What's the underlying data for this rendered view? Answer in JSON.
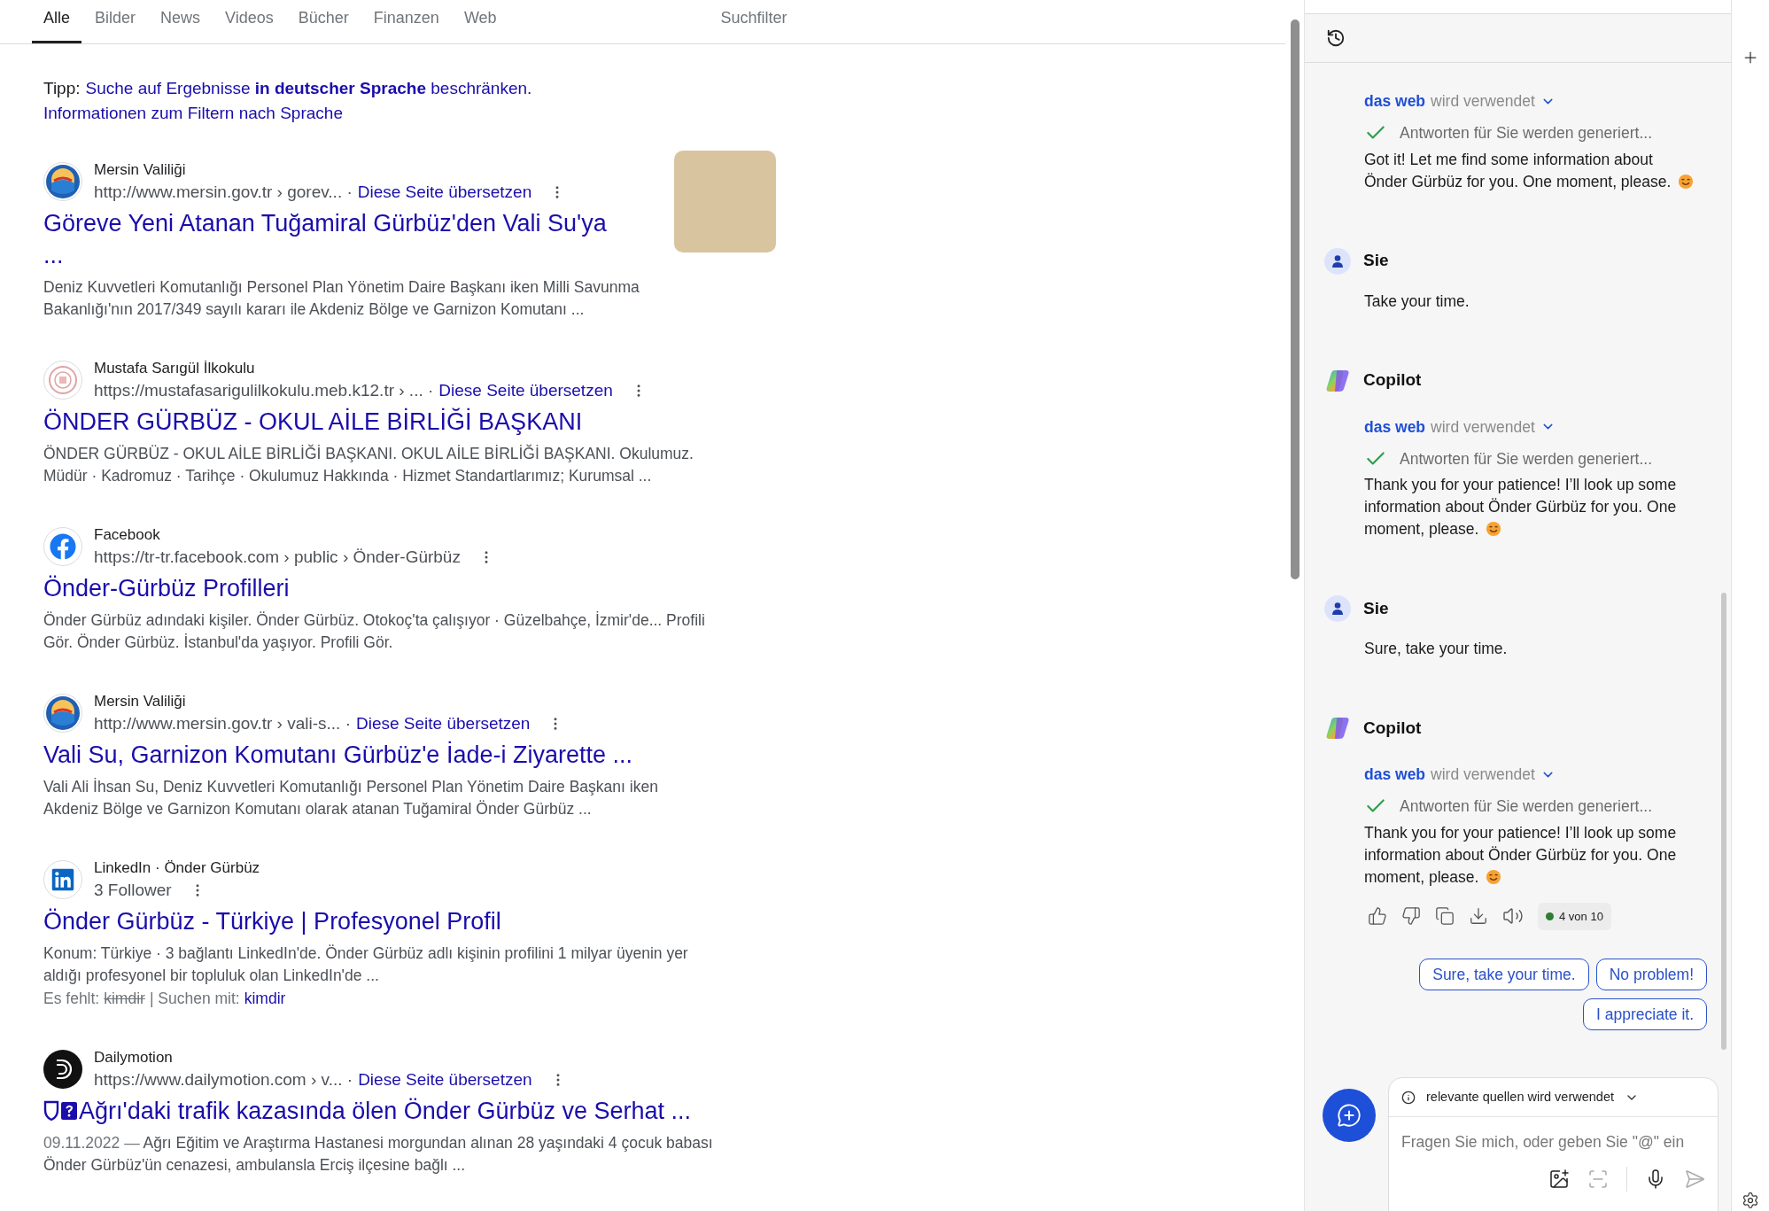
{
  "tabs": [
    {
      "label": "Alle",
      "selected": true
    },
    {
      "label": "Bilder",
      "selected": false
    },
    {
      "label": "News",
      "selected": false
    },
    {
      "label": "Videos",
      "selected": false
    },
    {
      "label": "Bücher",
      "selected": false
    },
    {
      "label": "Finanzen",
      "selected": false
    },
    {
      "label": "Web",
      "selected": false
    }
  ],
  "filter_button": "Suchfilter",
  "tip": {
    "label": "Tipp:",
    "link": "Suche auf Ergebnisse **in deutscher Sprache** beschränken.",
    "info_link": "Informationen zum Filtern nach Sprache"
  },
  "results": [
    {
      "kind": "gov",
      "site": "Mersin Valiliği",
      "url": "http://www.mersin.gov.tr › gorev... ·",
      "translate": "Diese Seite übersetzen",
      "title": "Göreve Yeni Atanan Tuğamiral Gürbüz'den Vali Su'ya ...",
      "snippet": "Deniz Kuvvetleri Komutanlığı Personel Plan Yönetim Daire Başkanı iken Milli Savunma Bakanlığı'nın 2017/349 sayılı kararı ile Akdeniz Bölge ve Garnizon Komutanı ...",
      "thumbnail": true
    },
    {
      "kind": "school",
      "site": "Mustafa Sarıgül İlkokulu",
      "url": "https://mustafasarigulilkokulu.meb.k12.tr › ... ·",
      "translate": "Diese Seite übersetzen",
      "title": "ÖNDER GÜRBÜZ - OKUL AİLE BİRLİĞİ BAŞKANI",
      "snippet": "ÖNDER GÜRBÜZ - OKUL AİLE BİRLİĞİ BAŞKANI. OKUL AİLE BİRLİĞİ BAŞKANI. Okulumuz. Müdür · Kadromuz · Tarihçe · Okulumuz Hakkında · Hizmet Standartlarımız; Kurumsal ..."
    },
    {
      "kind": "social",
      "site": "Facebook",
      "url": "https://tr-tr.facebook.com › public › Önder-Gürbüz",
      "title": "Önder-Gürbüz Profilleri",
      "snippet": "Önder Gürbüz adındaki kişiler. Önder Gürbüz. Otokoç'ta çalışıyor · Güzelbahçe, İzmir'de... Profili Gör. Önder Gürbüz. İstanbul'da yaşıyor. Profili Gör."
    },
    {
      "kind": "gov",
      "site": "Mersin Valiliği",
      "url": "http://www.mersin.gov.tr › vali-s... ·",
      "translate": "Diese Seite übersetzen",
      "title": "Vali Su, Garnizon Komutanı Gürbüz'e İade-i Ziyarette ...",
      "snippet": "Vali Ali İhsan Su, Deniz Kuvvetleri Komutanlığı Personel Plan Yönetim Daire Başkanı iken Akdeniz Bölge ve Garnizon Komutanı olarak atanan Tuğamiral Önder Gürbüz ..."
    },
    {
      "kind": "profile",
      "site": "LinkedIn · Önder Gürbüz",
      "url": "3 Follower",
      "title": "Önder Gürbüz - Türkiye | Profesyonel Profil",
      "snippet": "Konum: Türkiye · 3 bağlantı LinkedIn'de. Önder Gürbüz adlı kişinin profilini 1 milyar üyenin yer aldığı profesyonel bir topluluk olan LinkedIn'de ...",
      "missing": {
        "label": "Es fehlt:",
        "term": "kimdir",
        "search_label": "| Suchen mit:",
        "search_link": "kimdir"
      }
    },
    {
      "kind": "video",
      "site": "Dailymotion",
      "url": "https://www.dailymotion.com › v... ·",
      "translate": "Diese Seite übersetzen",
      "title": "Ağrı'daki trafik kazasında ölen Önder Gürbüz ve Serhat ...",
      "date": "09.11.2022 —",
      "snippet": "Ağrı Eğitim ve Araştırma Hastanesi morgundan alınan 28 yaşındaki 4 çocuk babası Önder Gürbüz'ün cenazesi, ambulansla Erciş ilçesine bağlı ..."
    }
  ],
  "chat": {
    "messages": [
      {
        "kind": "copilot",
        "source_link": "das web",
        "source_text": "wird verwendet",
        "status": "Antworten für Sie werden generiert...",
        "text": "Got it! Let me find some information about Önder Gürbüz for you. One moment, please."
      },
      {
        "kind": "user",
        "author": "Sie",
        "text": "Take your time."
      },
      {
        "kind": "copilot",
        "author": "Copilot",
        "source_link": "das web",
        "source_text": "wird verwendet",
        "status": "Antworten für Sie werden generiert...",
        "text": "Thank you for your patience! I’ll look up some information about Önder Gürbüz for you. One moment, please."
      },
      {
        "kind": "user",
        "author": "Sie",
        "text": "Sure, take your time."
      },
      {
        "kind": "copilot",
        "author": "Copilot",
        "source_link": "das web",
        "source_text": "wird verwendet",
        "status": "Antworten für Sie werden generiert...",
        "text": "Thank you for your patience! I’ll look up some information about Önder Gürbüz for you. One moment, please.",
        "counter": "4 von 10"
      }
    ],
    "suggestions": [
      "Sure, take your time.",
      "No problem!",
      "I appreciate it."
    ],
    "sources_label": "relevante quellen wird verwendet",
    "placeholder": "Fragen Sie mich, oder geben Sie \"@\" ein"
  }
}
